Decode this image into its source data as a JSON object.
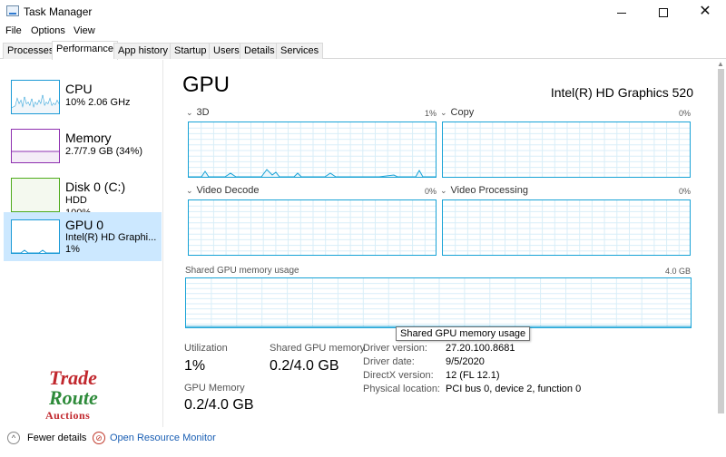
{
  "window": {
    "title": "Task Manager",
    "close_glyph": "✕"
  },
  "menu": [
    "File",
    "Options",
    "View"
  ],
  "tabs": [
    "Processes",
    "Performance",
    "App history",
    "Startup",
    "Users",
    "Details",
    "Services"
  ],
  "active_tab": "Performance",
  "sidebar": {
    "items": [
      {
        "title": "CPU",
        "line1": "10%  2.06 GHz",
        "line2": "",
        "color": "#1b9ad6",
        "icon": "cpu-graph-thumb"
      },
      {
        "title": "Memory",
        "line1": "2.7/7.9 GB (34%)",
        "line2": "",
        "color": "#8e2fb0",
        "icon": "memory-graph-thumb"
      },
      {
        "title": "Disk 0 (C:)",
        "line1": "HDD",
        "line2": "100%",
        "color": "#4dab1a",
        "icon": "disk-graph-thumb"
      },
      {
        "title": "GPU 0",
        "line1": "Intel(R) HD Graphi...",
        "line2": "1%",
        "color": "#1b9ad6",
        "icon": "gpu-graph-thumb"
      }
    ]
  },
  "main": {
    "title": "GPU",
    "model": "Intel(R) HD Graphics 520",
    "graphs": [
      {
        "label": "3D",
        "pct": "1%"
      },
      {
        "label": "Copy",
        "pct": "0%"
      },
      {
        "label": "Video Decode",
        "pct": "0%"
      },
      {
        "label": "Video Processing",
        "pct": "0%"
      }
    ],
    "shared_memory_graph": {
      "label": "Shared GPU memory usage",
      "max": "4.0 GB"
    },
    "tooltip": "Shared GPU memory usage",
    "stats": {
      "utilization_label": "Utilization",
      "utilization_value": "1%",
      "shared_memory_label": "Shared GPU memory",
      "shared_memory_value": "0.2/4.0 GB",
      "gpu_memory_label": "GPU Memory",
      "gpu_memory_value": "0.2/4.0 GB"
    },
    "details": [
      {
        "key": "Driver version:",
        "value": "27.20.100.8681"
      },
      {
        "key": "Driver date:",
        "value": "9/5/2020"
      },
      {
        "key": "DirectX version:",
        "value": "12 (FL 12.1)"
      },
      {
        "key": "Physical location:",
        "value": "PCI bus 0, device 2, function 0"
      }
    ]
  },
  "footer": {
    "fewer_details": "Fewer details",
    "open_monitor": "Open Resource Monitor"
  },
  "watermark": {
    "line1": "Trade",
    "line2": "Route",
    "line3": "Auctions"
  },
  "colors": {
    "accent": "#17a2d6",
    "selected": "#cce8ff",
    "link": "#1a5fb4"
  }
}
